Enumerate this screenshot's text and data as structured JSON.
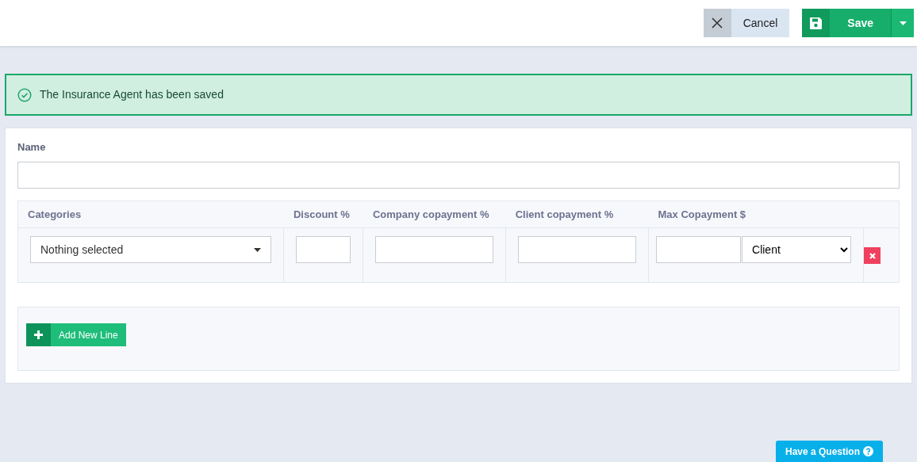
{
  "toolbar": {
    "cancel_label": "Cancel",
    "save_label": "Save"
  },
  "alert": {
    "message": "The Insurance Agent has been saved"
  },
  "form": {
    "name_label": "Name",
    "lines_table": {
      "columns": [
        "Categories",
        "Discount %",
        "Company copayment %",
        "Client copayment %",
        "Max Copayment $"
      ],
      "rows": [
        {
          "categories": "Nothing selected",
          "payer": "Client"
        }
      ]
    },
    "add_line_label": "Add New Line"
  },
  "help_button": "Have a Question"
}
